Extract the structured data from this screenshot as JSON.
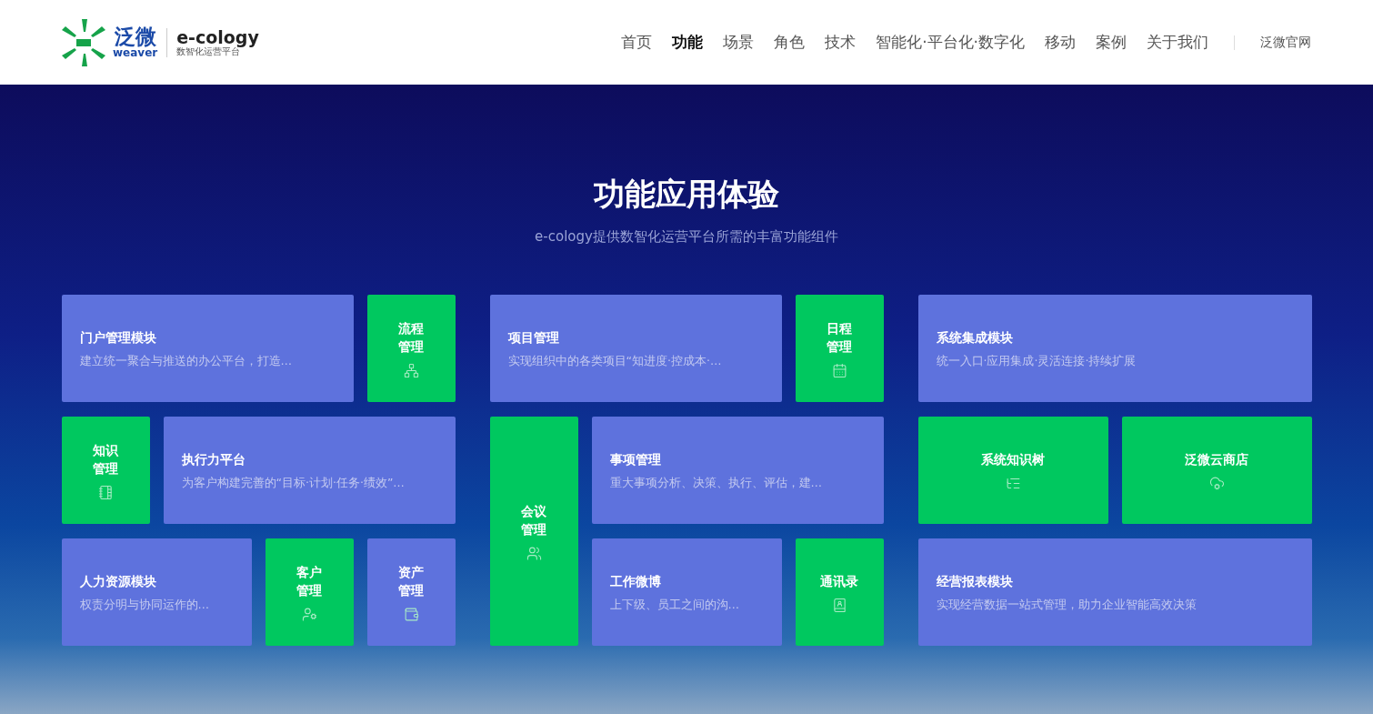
{
  "header": {
    "logo": {
      "brand_cn": "泛微",
      "brand_en": "weaver",
      "product": "e-cology",
      "tagline": "数智化运营平台"
    },
    "nav": [
      {
        "label": "首页",
        "selected": false
      },
      {
        "label": "功能",
        "selected": true
      },
      {
        "label": "场景",
        "selected": false
      },
      {
        "label": "角色",
        "selected": false
      },
      {
        "label": "技术",
        "selected": false
      },
      {
        "label": "智能化·平台化·数字化",
        "selected": false
      },
      {
        "label": "移动",
        "selected": false
      },
      {
        "label": "案例",
        "selected": false
      },
      {
        "label": "关于我们",
        "selected": false
      }
    ],
    "official_link": "泛微官网"
  },
  "hero": {
    "title": "功能应用体验",
    "subtitle": "e-cology提供数智化运营平台所需的丰富功能组件"
  },
  "groups": [
    {
      "tiles": [
        {
          "kind": "wide",
          "title": "门户管理模块",
          "description": "建立统一聚合与推送的办公平台，打造…",
          "color": "#5e72dd"
        },
        {
          "kind": "square",
          "title_lines": [
            "流程",
            "管理"
          ],
          "color": "#00c85f"
        },
        {
          "kind": "square",
          "title_lines": [
            "知识",
            "管理"
          ],
          "color": "#00c85f"
        },
        {
          "kind": "wide",
          "title": "执行力平台",
          "description": "为客户构建完善的“目标·计划·任务·绩效”…",
          "color": "#5e72dd"
        },
        {
          "kind": "wide",
          "title": "人力资源模块",
          "description": "权责分明与协同运作的…",
          "color": "#5e72dd"
        },
        {
          "kind": "square",
          "title_lines": [
            "客户",
            "管理"
          ],
          "color": "#00c85f"
        },
        {
          "kind": "square",
          "title_lines": [
            "资产",
            "管理"
          ],
          "color": "#5e72dd"
        }
      ]
    },
    {
      "tiles": [
        {
          "kind": "wide",
          "title": "项目管理",
          "description": "实现组织中的各类项目“知进度·控成本·…",
          "color": "#5e72dd"
        },
        {
          "kind": "square",
          "title_lines": [
            "日程",
            "管理"
          ],
          "color": "#00c85f"
        },
        {
          "kind": "square",
          "title_lines": [
            "会议",
            "管理"
          ],
          "color": "#00c85f"
        },
        {
          "kind": "wide",
          "title": "事项管理",
          "description": "重大事项分析、决策、执行、评估，建…",
          "color": "#5e72dd"
        },
        {
          "kind": "wide",
          "title": "工作微博",
          "description": "上下级、员工之间的沟…",
          "color": "#5e72dd"
        },
        {
          "kind": "square",
          "title_lines": [
            "通讯录"
          ],
          "color": "#00c85f"
        }
      ]
    },
    {
      "tiles": [
        {
          "kind": "wide",
          "title": "系统集成模块",
          "description": "统一入口·应用集成·灵活连接·持续扩展",
          "color": "#5e72dd"
        },
        {
          "kind": "square",
          "title_lines": [
            "系统知识树"
          ],
          "color": "#00c85f"
        },
        {
          "kind": "square",
          "title_lines": [
            "泛微云商店"
          ],
          "color": "#00c85f"
        },
        {
          "kind": "wide",
          "title": "经营报表模块",
          "description": "实现经营数据一站式管理，助力企业智能高效决策",
          "color": "#5e72dd"
        }
      ]
    }
  ]
}
